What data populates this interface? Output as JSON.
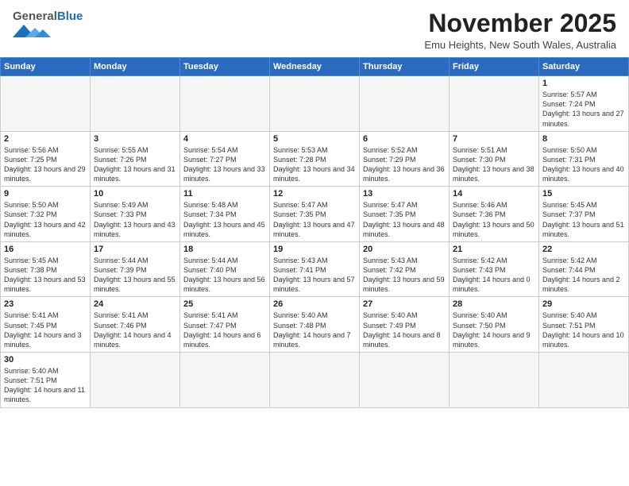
{
  "header": {
    "logo_general": "General",
    "logo_blue": "Blue",
    "month_title": "November 2025",
    "location": "Emu Heights, New South Wales, Australia"
  },
  "weekdays": [
    "Sunday",
    "Monday",
    "Tuesday",
    "Wednesday",
    "Thursday",
    "Friday",
    "Saturday"
  ],
  "weeks": [
    [
      {
        "day": "",
        "empty": true
      },
      {
        "day": "",
        "empty": true
      },
      {
        "day": "",
        "empty": true
      },
      {
        "day": "",
        "empty": true
      },
      {
        "day": "",
        "empty": true
      },
      {
        "day": "",
        "empty": true
      },
      {
        "day": "1",
        "sunrise": "Sunrise: 5:57 AM",
        "sunset": "Sunset: 7:24 PM",
        "daylight": "Daylight: 13 hours and 27 minutes."
      }
    ],
    [
      {
        "day": "2",
        "sunrise": "Sunrise: 5:56 AM",
        "sunset": "Sunset: 7:25 PM",
        "daylight": "Daylight: 13 hours and 29 minutes."
      },
      {
        "day": "3",
        "sunrise": "Sunrise: 5:55 AM",
        "sunset": "Sunset: 7:26 PM",
        "daylight": "Daylight: 13 hours and 31 minutes."
      },
      {
        "day": "4",
        "sunrise": "Sunrise: 5:54 AM",
        "sunset": "Sunset: 7:27 PM",
        "daylight": "Daylight: 13 hours and 33 minutes."
      },
      {
        "day": "5",
        "sunrise": "Sunrise: 5:53 AM",
        "sunset": "Sunset: 7:28 PM",
        "daylight": "Daylight: 13 hours and 34 minutes."
      },
      {
        "day": "6",
        "sunrise": "Sunrise: 5:52 AM",
        "sunset": "Sunset: 7:29 PM",
        "daylight": "Daylight: 13 hours and 36 minutes."
      },
      {
        "day": "7",
        "sunrise": "Sunrise: 5:51 AM",
        "sunset": "Sunset: 7:30 PM",
        "daylight": "Daylight: 13 hours and 38 minutes."
      },
      {
        "day": "8",
        "sunrise": "Sunrise: 5:50 AM",
        "sunset": "Sunset: 7:31 PM",
        "daylight": "Daylight: 13 hours and 40 minutes."
      }
    ],
    [
      {
        "day": "9",
        "sunrise": "Sunrise: 5:50 AM",
        "sunset": "Sunset: 7:32 PM",
        "daylight": "Daylight: 13 hours and 42 minutes."
      },
      {
        "day": "10",
        "sunrise": "Sunrise: 5:49 AM",
        "sunset": "Sunset: 7:33 PM",
        "daylight": "Daylight: 13 hours and 43 minutes."
      },
      {
        "day": "11",
        "sunrise": "Sunrise: 5:48 AM",
        "sunset": "Sunset: 7:34 PM",
        "daylight": "Daylight: 13 hours and 45 minutes."
      },
      {
        "day": "12",
        "sunrise": "Sunrise: 5:47 AM",
        "sunset": "Sunset: 7:35 PM",
        "daylight": "Daylight: 13 hours and 47 minutes."
      },
      {
        "day": "13",
        "sunrise": "Sunrise: 5:47 AM",
        "sunset": "Sunset: 7:35 PM",
        "daylight": "Daylight: 13 hours and 48 minutes."
      },
      {
        "day": "14",
        "sunrise": "Sunrise: 5:46 AM",
        "sunset": "Sunset: 7:36 PM",
        "daylight": "Daylight: 13 hours and 50 minutes."
      },
      {
        "day": "15",
        "sunrise": "Sunrise: 5:45 AM",
        "sunset": "Sunset: 7:37 PM",
        "daylight": "Daylight: 13 hours and 51 minutes."
      }
    ],
    [
      {
        "day": "16",
        "sunrise": "Sunrise: 5:45 AM",
        "sunset": "Sunset: 7:38 PM",
        "daylight": "Daylight: 13 hours and 53 minutes."
      },
      {
        "day": "17",
        "sunrise": "Sunrise: 5:44 AM",
        "sunset": "Sunset: 7:39 PM",
        "daylight": "Daylight: 13 hours and 55 minutes."
      },
      {
        "day": "18",
        "sunrise": "Sunrise: 5:44 AM",
        "sunset": "Sunset: 7:40 PM",
        "daylight": "Daylight: 13 hours and 56 minutes."
      },
      {
        "day": "19",
        "sunrise": "Sunrise: 5:43 AM",
        "sunset": "Sunset: 7:41 PM",
        "daylight": "Daylight: 13 hours and 57 minutes."
      },
      {
        "day": "20",
        "sunrise": "Sunrise: 5:43 AM",
        "sunset": "Sunset: 7:42 PM",
        "daylight": "Daylight: 13 hours and 59 minutes."
      },
      {
        "day": "21",
        "sunrise": "Sunrise: 5:42 AM",
        "sunset": "Sunset: 7:43 PM",
        "daylight": "Daylight: 14 hours and 0 minutes."
      },
      {
        "day": "22",
        "sunrise": "Sunrise: 5:42 AM",
        "sunset": "Sunset: 7:44 PM",
        "daylight": "Daylight: 14 hours and 2 minutes."
      }
    ],
    [
      {
        "day": "23",
        "sunrise": "Sunrise: 5:41 AM",
        "sunset": "Sunset: 7:45 PM",
        "daylight": "Daylight: 14 hours and 3 minutes."
      },
      {
        "day": "24",
        "sunrise": "Sunrise: 5:41 AM",
        "sunset": "Sunset: 7:46 PM",
        "daylight": "Daylight: 14 hours and 4 minutes."
      },
      {
        "day": "25",
        "sunrise": "Sunrise: 5:41 AM",
        "sunset": "Sunset: 7:47 PM",
        "daylight": "Daylight: 14 hours and 6 minutes."
      },
      {
        "day": "26",
        "sunrise": "Sunrise: 5:40 AM",
        "sunset": "Sunset: 7:48 PM",
        "daylight": "Daylight: 14 hours and 7 minutes."
      },
      {
        "day": "27",
        "sunrise": "Sunrise: 5:40 AM",
        "sunset": "Sunset: 7:49 PM",
        "daylight": "Daylight: 14 hours and 8 minutes."
      },
      {
        "day": "28",
        "sunrise": "Sunrise: 5:40 AM",
        "sunset": "Sunset: 7:50 PM",
        "daylight": "Daylight: 14 hours and 9 minutes."
      },
      {
        "day": "29",
        "sunrise": "Sunrise: 5:40 AM",
        "sunset": "Sunset: 7:51 PM",
        "daylight": "Daylight: 14 hours and 10 minutes."
      }
    ],
    [
      {
        "day": "30",
        "sunrise": "Sunrise: 5:40 AM",
        "sunset": "Sunset: 7:51 PM",
        "daylight": "Daylight: 14 hours and 11 minutes."
      },
      {
        "day": "",
        "empty": true
      },
      {
        "day": "",
        "empty": true
      },
      {
        "day": "",
        "empty": true
      },
      {
        "day": "",
        "empty": true
      },
      {
        "day": "",
        "empty": true
      },
      {
        "day": "",
        "empty": true
      }
    ]
  ]
}
